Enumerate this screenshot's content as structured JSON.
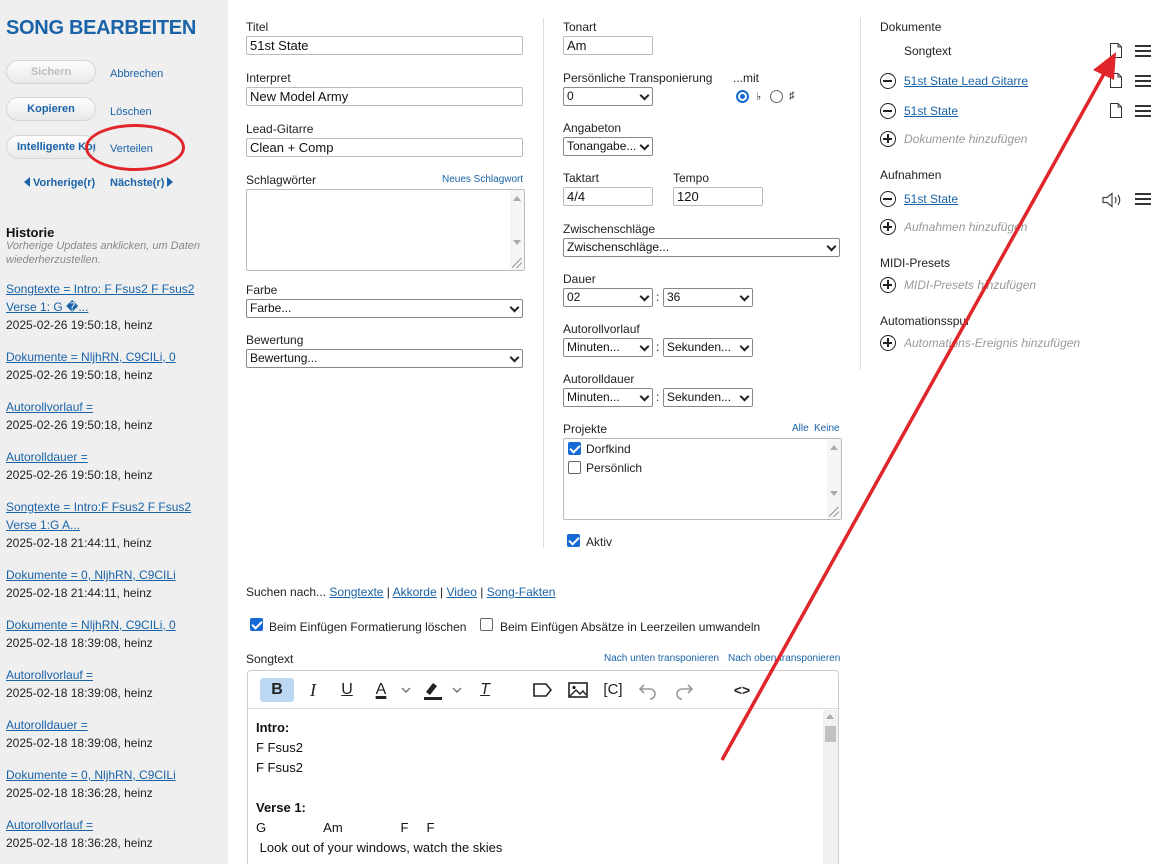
{
  "sidebar": {
    "title": "SONG BEARBEITEN",
    "save_label": "Sichern",
    "cancel_label": "Abbrechen",
    "copy_label": "Kopieren",
    "delete_label": "Löschen",
    "smart_copy_label": "Intelligente Kopie",
    "distribute_label": "Verteilen",
    "prev_label": "Vorherige(r)",
    "next_label": "Nächste(r)",
    "history_title": "Historie",
    "history_hint": "Vorherige Updates anklicken, um Daten wiederherzustellen.",
    "history": [
      {
        "change_line1": "Songtexte = Intro: F Fsus2  F Fsus2",
        "change_line2": "Verse 1: G            �...",
        "meta": "2025-02-26 19:50:18, heinz"
      },
      {
        "change_line1": "Dokumente = NljhRN, C9CILi, 0",
        "change_line2": "",
        "meta": "2025-02-26 19:50:18, heinz"
      },
      {
        "change_line1": "Autorollvorlauf =",
        "change_line2": "",
        "meta": "2025-02-26 19:50:18, heinz"
      },
      {
        "change_line1": "Autorolldauer =",
        "change_line2": "",
        "meta": "2025-02-26 19:50:18, heinz"
      },
      {
        "change_line1": "Songtexte = Intro:F Fsus2 F Fsus2",
        "change_line2": "Verse 1:G              A...",
        "meta": "2025-02-18 21:44:11, heinz"
      },
      {
        "change_line1": "Dokumente = 0, NljhRN, C9CILi",
        "change_line2": "",
        "meta": "2025-02-18 21:44:11, heinz"
      },
      {
        "change_line1": "Dokumente = NljhRN, C9CILi, 0",
        "change_line2": "",
        "meta": "2025-02-18 18:39:08, heinz"
      },
      {
        "change_line1": "Autorollvorlauf =",
        "change_line2": "",
        "meta": "2025-02-18 18:39:08, heinz"
      },
      {
        "change_line1": "Autorolldauer =",
        "change_line2": "",
        "meta": "2025-02-18 18:39:08, heinz"
      },
      {
        "change_line1": "Dokumente = 0, NljhRN, C9CILi",
        "change_line2": "",
        "meta": "2025-02-18 18:36:28, heinz"
      },
      {
        "change_line1": "Autorollvorlauf =",
        "change_line2": "",
        "meta": "2025-02-18 18:36:28, heinz"
      }
    ]
  },
  "form": {
    "title_label": "Titel",
    "title_value": "51st State",
    "artist_label": "Interpret",
    "artist_value": "New Model Army",
    "lead_label": "Lead-Gitarre",
    "lead_value": "Clean + Comp",
    "keywords_label": "Schlagwörter",
    "new_keyword_link": "Neues Schlagwort",
    "color_label": "Farbe",
    "color_value": "Farbe...",
    "rating_label": "Bewertung",
    "rating_value": "Bewertung...",
    "key_label": "Tonart",
    "key_value": "Am",
    "transpose_label": "Persönliche Transponierung",
    "transpose_value": "0",
    "with_label": "...mit",
    "flat_symbol": "♭",
    "sharp_symbol": "♯",
    "count_in_label": "Angabeton",
    "count_in_value": "Tonangabe...",
    "meter_label": "Taktart",
    "meter_value": "4/4",
    "tempo_label": "Tempo",
    "tempo_value": "120",
    "strikes_label": "Zwischenschläge",
    "strikes_value": "Zwischenschläge...",
    "duration_label": "Dauer",
    "duration_min": "02",
    "duration_sec": "36",
    "scroll_pre_label": "Autorollvorlauf",
    "scroll_pre_min": "Minuten...",
    "scroll_pre_sec": "Sekunden...",
    "scroll_dur_label": "Autorolldauer",
    "scroll_dur_min": "Minuten...",
    "scroll_dur_sec": "Sekunden...",
    "projects_label": "Projekte",
    "projects_all": "Alle",
    "projects_none": "Keine",
    "projects": [
      {
        "name": "Dorfkind",
        "checked": true
      },
      {
        "name": "Persönlich",
        "checked": false
      }
    ],
    "active_label": "Aktiv",
    "search_prefix": "Suchen nach...",
    "search_links": [
      "Songtexte",
      "Akkorde",
      "Video",
      "Song-Fakten"
    ],
    "search_sep": "|",
    "paste_clear_label": "Beim Einfügen Formatierung löschen",
    "paste_paragraph_label": "Beim Einfügen Absätze in Leerzeilen umwandeln",
    "lyrics_label": "Songtext",
    "transpose_down": "Nach unten transponieren",
    "transpose_up": "Nach oben transponieren",
    "toolbar": {
      "bold": "B",
      "italic": "I",
      "underline": "U",
      "color": "A",
      "clear": "T",
      "chord": "[C]",
      "code": "<>"
    },
    "lyrics_lines": [
      {
        "text": "Intro:",
        "bold": true
      },
      {
        "text": "F Fsus2",
        "bold": false
      },
      {
        "text": "F Fsus2",
        "bold": false
      },
      {
        "text": "",
        "bold": false
      },
      {
        "text": "Verse 1:",
        "bold": true
      },
      {
        "text": "G                Am                F     F",
        "bold": false
      },
      {
        "text": " Look out of your windows, watch the skies",
        "bold": false
      }
    ]
  },
  "documents": {
    "title": "Dokumente",
    "lyrics_item": "Songtext",
    "items": [
      "51st State Lead Gitarre",
      "51st State"
    ],
    "add_label": "Dokumente hinzufügen"
  },
  "recordings": {
    "title": "Aufnahmen",
    "items": [
      "51st State"
    ],
    "add_label": "Aufnahmen hinzufügen"
  },
  "midi": {
    "title": "MIDI-Presets",
    "add_label": "MIDI-Presets hinzufügen"
  },
  "automation": {
    "title": "Automationsspur",
    "add_label": "Automations-Ereignis hinzufügen"
  },
  "colors": {
    "accent": "#1a63a8",
    "annotation": "#e0262a",
    "checkbox": "#1769d6"
  }
}
